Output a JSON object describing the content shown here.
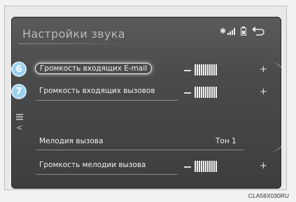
{
  "screen": {
    "title": "Настройки звука",
    "status_icons": [
      "bluetooth-icon",
      "signal-icon",
      "battery-icon",
      "back-icon"
    ],
    "rows": [
      {
        "badge": "6",
        "label": "Громкость входящих E-mail",
        "control": "volume",
        "highlighted": true
      },
      {
        "badge": "7",
        "label": "Громкость входящих вызовов",
        "control": "volume",
        "highlighted": false
      },
      {
        "label": "Мелодия вызова",
        "value": "Тон 1"
      },
      {
        "label": "Громкость мелодии вызова",
        "control": "volume",
        "highlighted": false
      }
    ],
    "side_icons": [
      "list-icon",
      "chevron-left-icon"
    ],
    "plus_symbol": "+",
    "minus_symbol": "−"
  },
  "figure_code": "CLA58X030RU",
  "colors": {
    "badge": "#9bd1f0",
    "screen_bg": "#4a4a4a"
  }
}
